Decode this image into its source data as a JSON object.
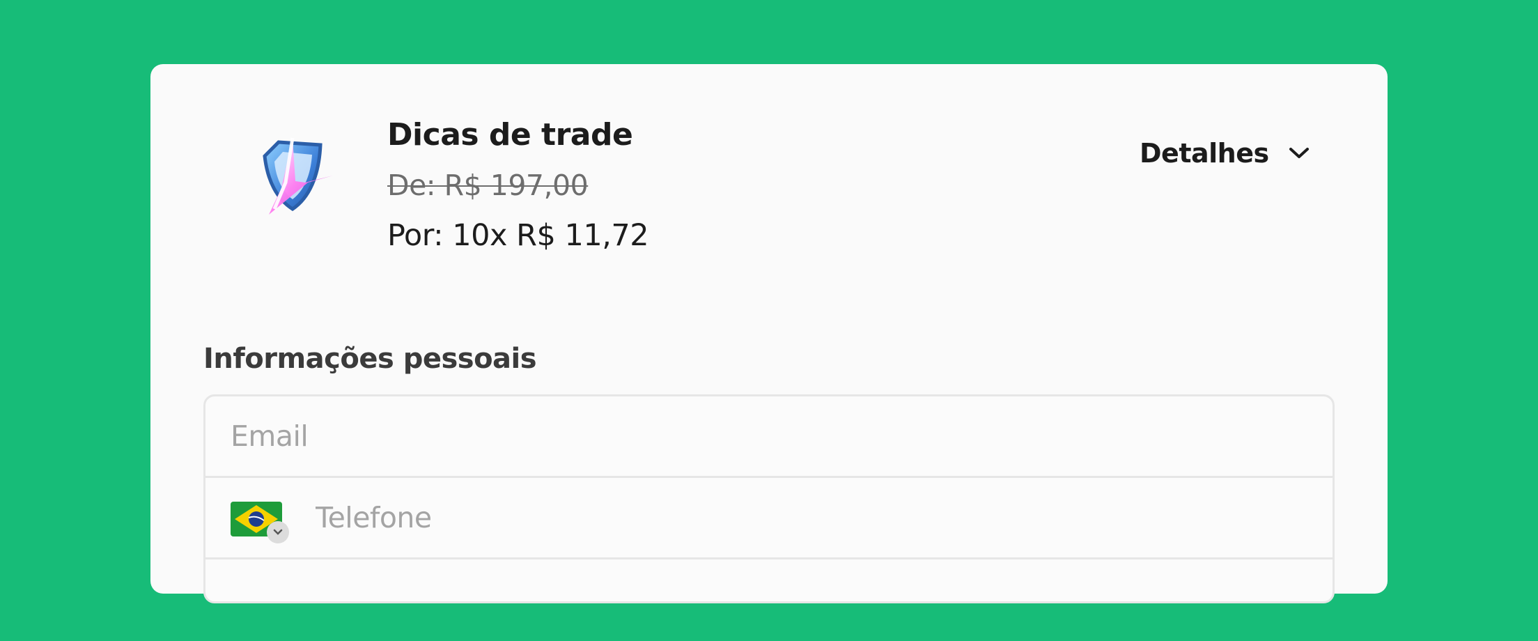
{
  "product": {
    "name": "Dicas de trade",
    "old_price": "De: R$ 197,00",
    "new_price": "Por: 10x R$ 11,72",
    "logo_icon": "shield-lightning-logo"
  },
  "details": {
    "label": "Detalhes",
    "icon": "chevron-down-icon"
  },
  "personal_info": {
    "title": "Informações pessoais",
    "email": {
      "placeholder": "Email",
      "value": ""
    },
    "phone": {
      "placeholder": "Telefone",
      "value": "",
      "country_flag": "brazil-flag"
    }
  },
  "colors": {
    "background": "#17bc78",
    "card": "#fafafa",
    "text": "#1c1c1c",
    "placeholder": "#a4a4a4"
  }
}
